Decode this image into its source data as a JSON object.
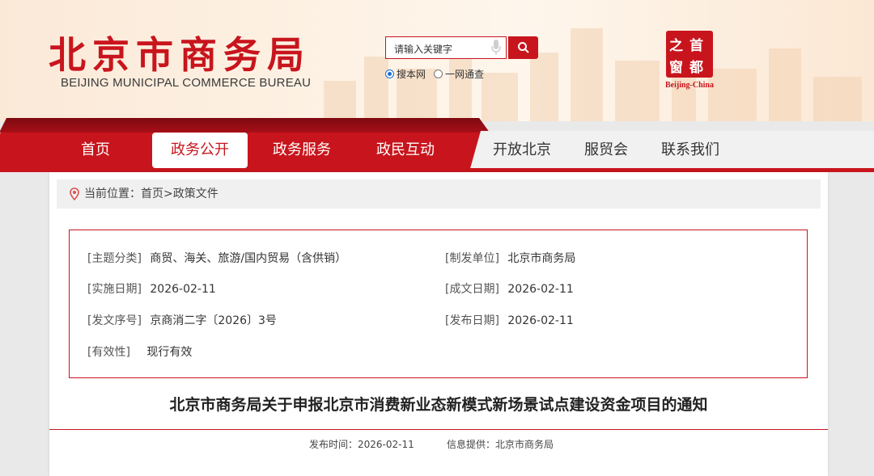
{
  "header": {
    "title_cn": "北京市商务局",
    "title_en": "BEIJING MUNICIPAL COMMERCE BUREAU",
    "search": {
      "placeholder": "请输入关键字"
    },
    "scope_options": [
      {
        "label": "搜本网",
        "selected": true
      },
      {
        "label": "一网通查",
        "selected": false
      }
    ],
    "badge": {
      "chars": [
        "之",
        "首",
        "窗",
        "都"
      ],
      "caption": "Beijing-China"
    }
  },
  "nav": {
    "items": [
      {
        "label": "首页",
        "active": false
      },
      {
        "label": "政务公开",
        "active": true
      },
      {
        "label": "政务服务",
        "active": false
      },
      {
        "label": "政民互动",
        "active": false
      },
      {
        "label": "开放北京",
        "active": false
      },
      {
        "label": "服贸会",
        "active": false
      },
      {
        "label": "联系我们",
        "active": false
      }
    ]
  },
  "breadcrumb": {
    "prefix": "当前位置：",
    "home": "首页",
    "sep": ">",
    "current": "政策文件"
  },
  "meta": {
    "topic_key": "[主题分类]",
    "topic_val": "商贸、海关、旅游/国内贸易（含供销）",
    "issuer_key": "[制发单位]",
    "issuer_val": "北京市商务局",
    "effective_key": "[实施日期]",
    "effective_val": "2026-02-11",
    "written_key": "[成文日期]",
    "written_val": "2026-02-11",
    "docno_key": "[发文序号]",
    "docno_val": "京商消二字〔2026〕3号",
    "published_key": "[发布日期]",
    "published_val": "2026-02-11",
    "validity_key": "[有效性]",
    "validity_val": "现行有效"
  },
  "article": {
    "title": "北京市商务局关于申报北京市消费新业态新模式新场景试点建设资金项目的通知",
    "pub_time_label": "发布时间：",
    "pub_time": "2026-02-11",
    "source_label": "信息提供：",
    "source": "北京市商务局"
  },
  "colors": {
    "brand_red": "#c8151d",
    "nav_gray": "#f1f1f1",
    "page_bg": "#e9e9e9"
  }
}
